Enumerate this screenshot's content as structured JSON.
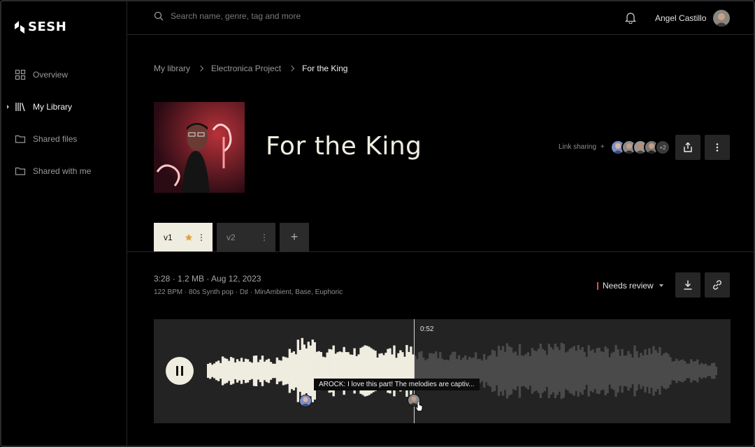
{
  "app": {
    "brand": "SESH"
  },
  "sidebar": {
    "items": [
      {
        "label": "Overview",
        "icon": "grid-icon"
      },
      {
        "label": "My Library",
        "icon": "library-icon",
        "active": true
      },
      {
        "label": "Shared files",
        "icon": "folder-icon"
      },
      {
        "label": "Shared with me",
        "icon": "folder-icon"
      }
    ]
  },
  "topbar": {
    "search_placeholder": "Search name, genre, tag and more",
    "user_name": "Angel Castillo"
  },
  "breadcrumb": [
    "My library",
    "Electronica Project",
    "For the King"
  ],
  "track": {
    "title": "For the King",
    "link_sharing_label": "Link sharing",
    "link_sharing_plus": "+",
    "more_collaborators": "+2"
  },
  "versions": [
    {
      "label": "v1",
      "starred": true,
      "selected": true
    },
    {
      "label": "v2",
      "starred": false,
      "selected": false
    }
  ],
  "add_version_label": "+",
  "meta": {
    "line1": "3:28 · 1.2 MB · Aug 12, 2023",
    "line2": "122 BPM · 80s Synth pop · D♯ · MinAmbient, Base, Euphoric"
  },
  "status": {
    "label": "Needs review",
    "color": "#e5533d"
  },
  "player": {
    "playing": true,
    "current_time": "0:52",
    "progress": 0.405,
    "comment_text": "AROCK: I love this part! The melodies are captiv..."
  },
  "colors": {
    "accent_cream": "#efece0",
    "panel": "#232323",
    "button": "#262626",
    "waveform_played": "#efece0",
    "waveform_unplayed": "#4a4a4a",
    "star": "#e0a13a"
  }
}
